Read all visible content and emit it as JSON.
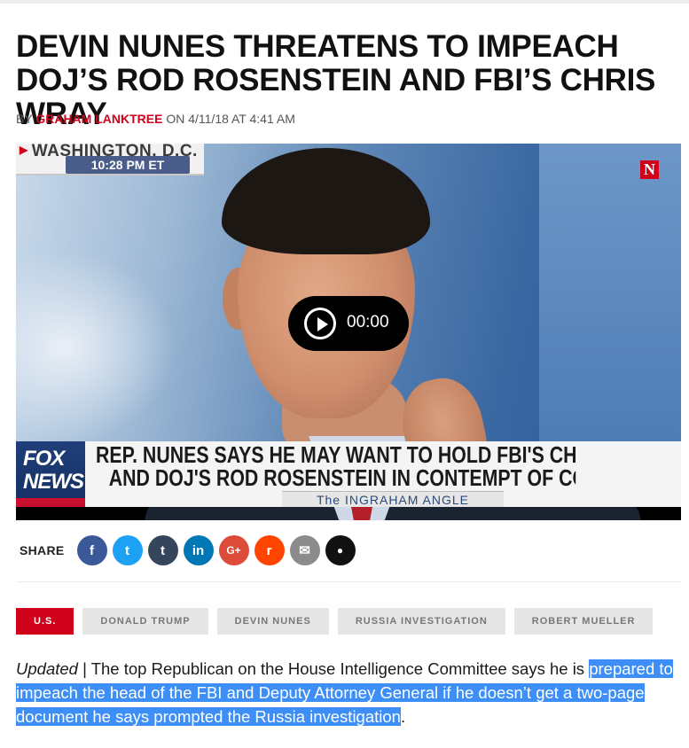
{
  "article": {
    "headline": "DEVIN NUNES THREATENS TO IMPEACH DOJ’S ROD ROSENSTEIN AND FBI’S CHRIS WRAY",
    "byline_prefix": "BY",
    "author": "GRAHAM LANKTREE",
    "byline_on": "ON 4/11/18 AT 4:41 AM"
  },
  "video": {
    "location": "WASHINGTON, D.C.",
    "time": "10:28 PM ET",
    "brand_badge": "N",
    "network_logo_line1": "FOX",
    "network_logo_line2": "NEWS",
    "lower_third_line1": "REP. NUNES SAYS HE MAY WANT TO HOLD FBI'S CHRIS WRA",
    "lower_third_line2": "AND DOJ'S ROD ROSENSTEIN IN CONTEMPT OF CONGRESS",
    "show_name": "The INGRAHAM ANGLE",
    "player_time": "00:00"
  },
  "share": {
    "label": "SHARE",
    "buttons": [
      {
        "name": "facebook",
        "glyph": "f",
        "color": "#3b5998"
      },
      {
        "name": "twitter",
        "glyph": "t",
        "color": "#1da1f2"
      },
      {
        "name": "tumblr",
        "glyph": "t",
        "color": "#35465c"
      },
      {
        "name": "linkedin",
        "glyph": "in",
        "color": "#0077b5"
      },
      {
        "name": "google-plus",
        "glyph": "G+",
        "color": "#dd4b39"
      },
      {
        "name": "reddit",
        "glyph": "r",
        "color": "#ff4500"
      },
      {
        "name": "email",
        "glyph": "✉",
        "color": "#8c8c8c"
      },
      {
        "name": "comment",
        "glyph": "●",
        "color": "#111111"
      }
    ]
  },
  "tags": [
    "U.S.",
    "DONALD TRUMP",
    "DEVIN NUNES",
    "RUSSIA INVESTIGATION",
    "ROBERT MUELLER"
  ],
  "body": {
    "updated": "Updated",
    "separator": " | ",
    "text_before_selection": "The top Republican on the House Intelligence Committee says he is ",
    "selected_text": "prepared to impeach the head of the FBI and Deputy Attorney General if he doesn’t get a two-page document he says prompted the Russia investigation",
    "text_after_selection": "."
  },
  "colors": {
    "accent": "#d0021b",
    "selection": "#3d8ef7",
    "tag_bg": "#e6e6e6"
  }
}
